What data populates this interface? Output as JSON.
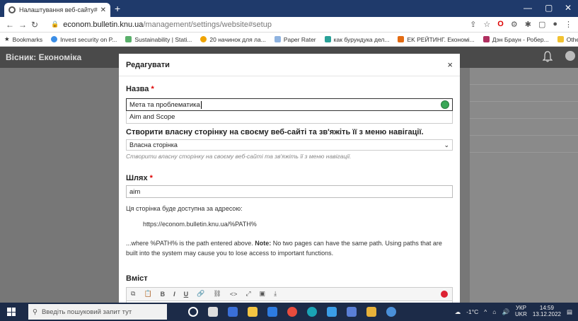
{
  "browser": {
    "tab_title": "Налаштування веб-сайту#Econ",
    "url_host": "econom.bulletin.knu.ua",
    "url_path": "/management/settings/website#setup",
    "bookmarks": [
      "Bookmarks",
      "Invest security on P...",
      "Sustainability | Stati...",
      "20 начинок для ла...",
      "Paper Rater",
      "как бурундука дел...",
      "EK  РЕЙТИНГ. Економі...",
      "Дэн Браун - Робер..."
    ],
    "other_bookmarks": "Other bookmarks"
  },
  "app": {
    "title": "Вісник: Економіка"
  },
  "modal": {
    "title": "Редагувати",
    "close": "×",
    "name_label": "Назва",
    "required_mark": "*",
    "name_value": "Мета та проблематика",
    "name_alt_value": "Aim and Scope",
    "nav_label": "Створити власну сторінку на своєму веб-сайті та зв'яжіть її з меню навігації.",
    "select_value": "Власна сторінка",
    "select_help": "Створити власну сторінку на своєму веб-сайті та зв'яжіть її з меню навігації.",
    "path_label": "Шлях",
    "path_value": "aim",
    "available_text": "Ця сторінка буде доступна за адресою:",
    "url_example": "https://econom.bulletin.knu.ua/%PATH%",
    "note_prefix": "...where %PATH% is the path entered above. ",
    "note_bold": "Note:",
    "note_suffix": " No two pages can have the same path. Using paths that are built into the system may cause you to lose access to important functions.",
    "content_label": "Вміст"
  },
  "taskbar": {
    "search_placeholder": "Введіть пошуковий запит тут",
    "weather": "-1°C",
    "lang_top": "УКР",
    "lang_bottom": "UKR",
    "time": "14:59",
    "date": "13.12.2022"
  },
  "colors": {
    "tabbar": "#1f3a6b",
    "app_header": "#4a4a4a",
    "overlay": "#777777",
    "required": "#dd0000"
  }
}
